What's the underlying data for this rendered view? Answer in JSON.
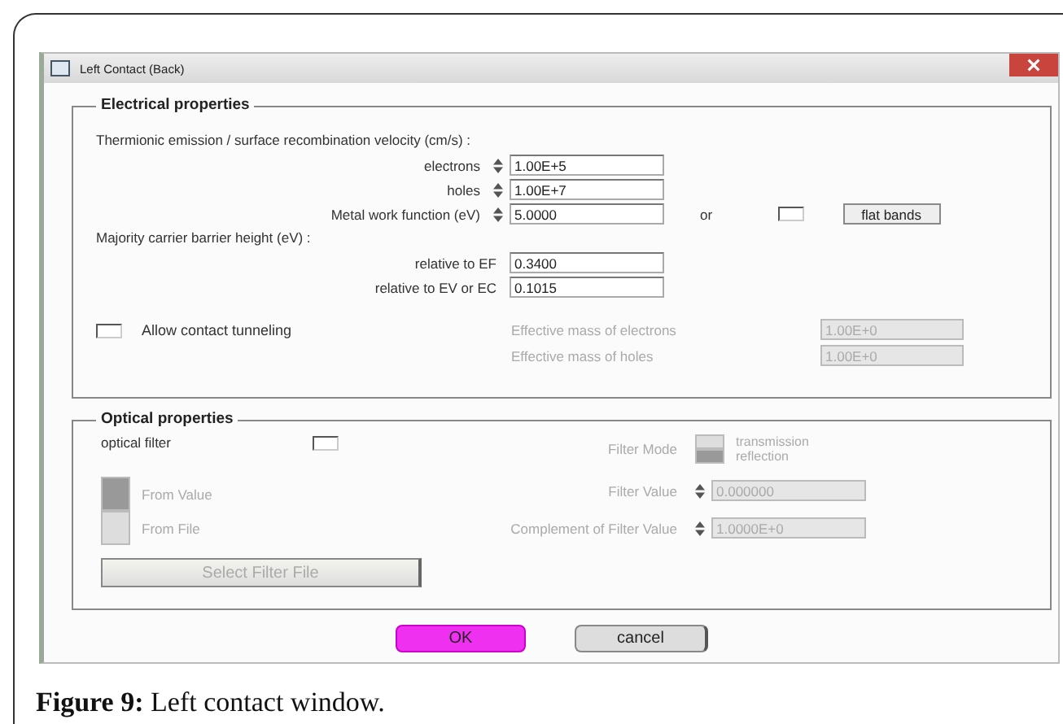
{
  "window": {
    "title": "Left Contact (Back)"
  },
  "electrical": {
    "legend": "Electrical properties",
    "velocity_heading": "Thermionic emission / surface recombination velocity (cm/s) :",
    "velocities": [
      {
        "label": "electrons",
        "value": "1.00E+5"
      },
      {
        "label": "holes",
        "value": "1.00E+7"
      }
    ],
    "work_function": {
      "label": "Metal work function (eV)",
      "value": "5.0000",
      "or": "or",
      "flat_bands_checked": false,
      "flat_bands_button": "flat bands"
    },
    "barrier_heading": "Majority carrier barrier height (eV) :",
    "barriers": [
      {
        "label": "relative to EF",
        "value": "0.3400"
      },
      {
        "label": "relative to EV or EC",
        "value": "0.1015"
      }
    ],
    "tunneling": {
      "label": "Allow contact tunneling",
      "checked": false
    },
    "masses": [
      {
        "label": "Effective mass of electrons",
        "value": "1.00E+0",
        "disabled": true
      },
      {
        "label": "Effective mass of holes",
        "value": "1.00E+0",
        "disabled": true
      }
    ]
  },
  "optical": {
    "legend": "Optical properties",
    "filter_label": "optical filter",
    "filter_checked": false,
    "filter_mode": {
      "label": "Filter Mode",
      "disabled": true,
      "options": [
        {
          "label": "transmission",
          "selected": false
        },
        {
          "label": "reflection",
          "selected": true
        }
      ]
    },
    "source": {
      "disabled": true,
      "options": [
        {
          "label": "From Value",
          "selected": true
        },
        {
          "label": "From File",
          "selected": false
        }
      ]
    },
    "values": [
      {
        "label": "Filter Value",
        "value": "0.000000",
        "disabled": true
      },
      {
        "label": "Complement of Filter Value",
        "value": "1.0000E+0",
        "disabled": true
      }
    ],
    "select_button": {
      "label": "Select Filter File",
      "disabled": true
    }
  },
  "buttons": [
    {
      "label": "OK",
      "kind": "primary"
    },
    {
      "label": "cancel",
      "kind": "plain"
    }
  ],
  "caption": "**Figure 9:** Left contact window."
}
